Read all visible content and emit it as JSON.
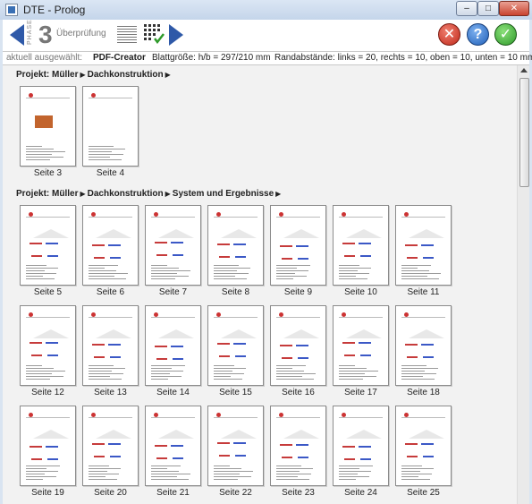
{
  "window": {
    "title": "DTE - Prolog"
  },
  "toolbar": {
    "phase_label": "PHASE",
    "phase_number": "3",
    "step_label": "Überprüfung"
  },
  "info": {
    "selected_label": "aktuell ausgewählt:",
    "printer": "PDF-Creator",
    "paper": "Blattgröße: h/b = 297/210 mm",
    "margins": "Randabstände: links = 20, rechts = 10, oben = 10, unten = 10 mm"
  },
  "sections": [
    {
      "path": [
        "Projekt: Müller",
        "Dachkonstruktion"
      ],
      "pages": [
        "Seite 3",
        "Seite 4"
      ]
    },
    {
      "path": [
        "Projekt: Müller",
        "Dachkonstruktion",
        "System und Ergebnisse"
      ],
      "pages": [
        "Seite 5",
        "Seite 6",
        "Seite 7",
        "Seite 8",
        "Seite 9",
        "Seite 10",
        "Seite 11",
        "Seite 12",
        "Seite 13",
        "Seite 14",
        "Seite 15",
        "Seite 16",
        "Seite 17",
        "Seite 18",
        "Seite 19",
        "Seite 20",
        "Seite 21",
        "Seite 22",
        "Seite 23",
        "Seite 24",
        "Seite 25"
      ]
    }
  ]
}
